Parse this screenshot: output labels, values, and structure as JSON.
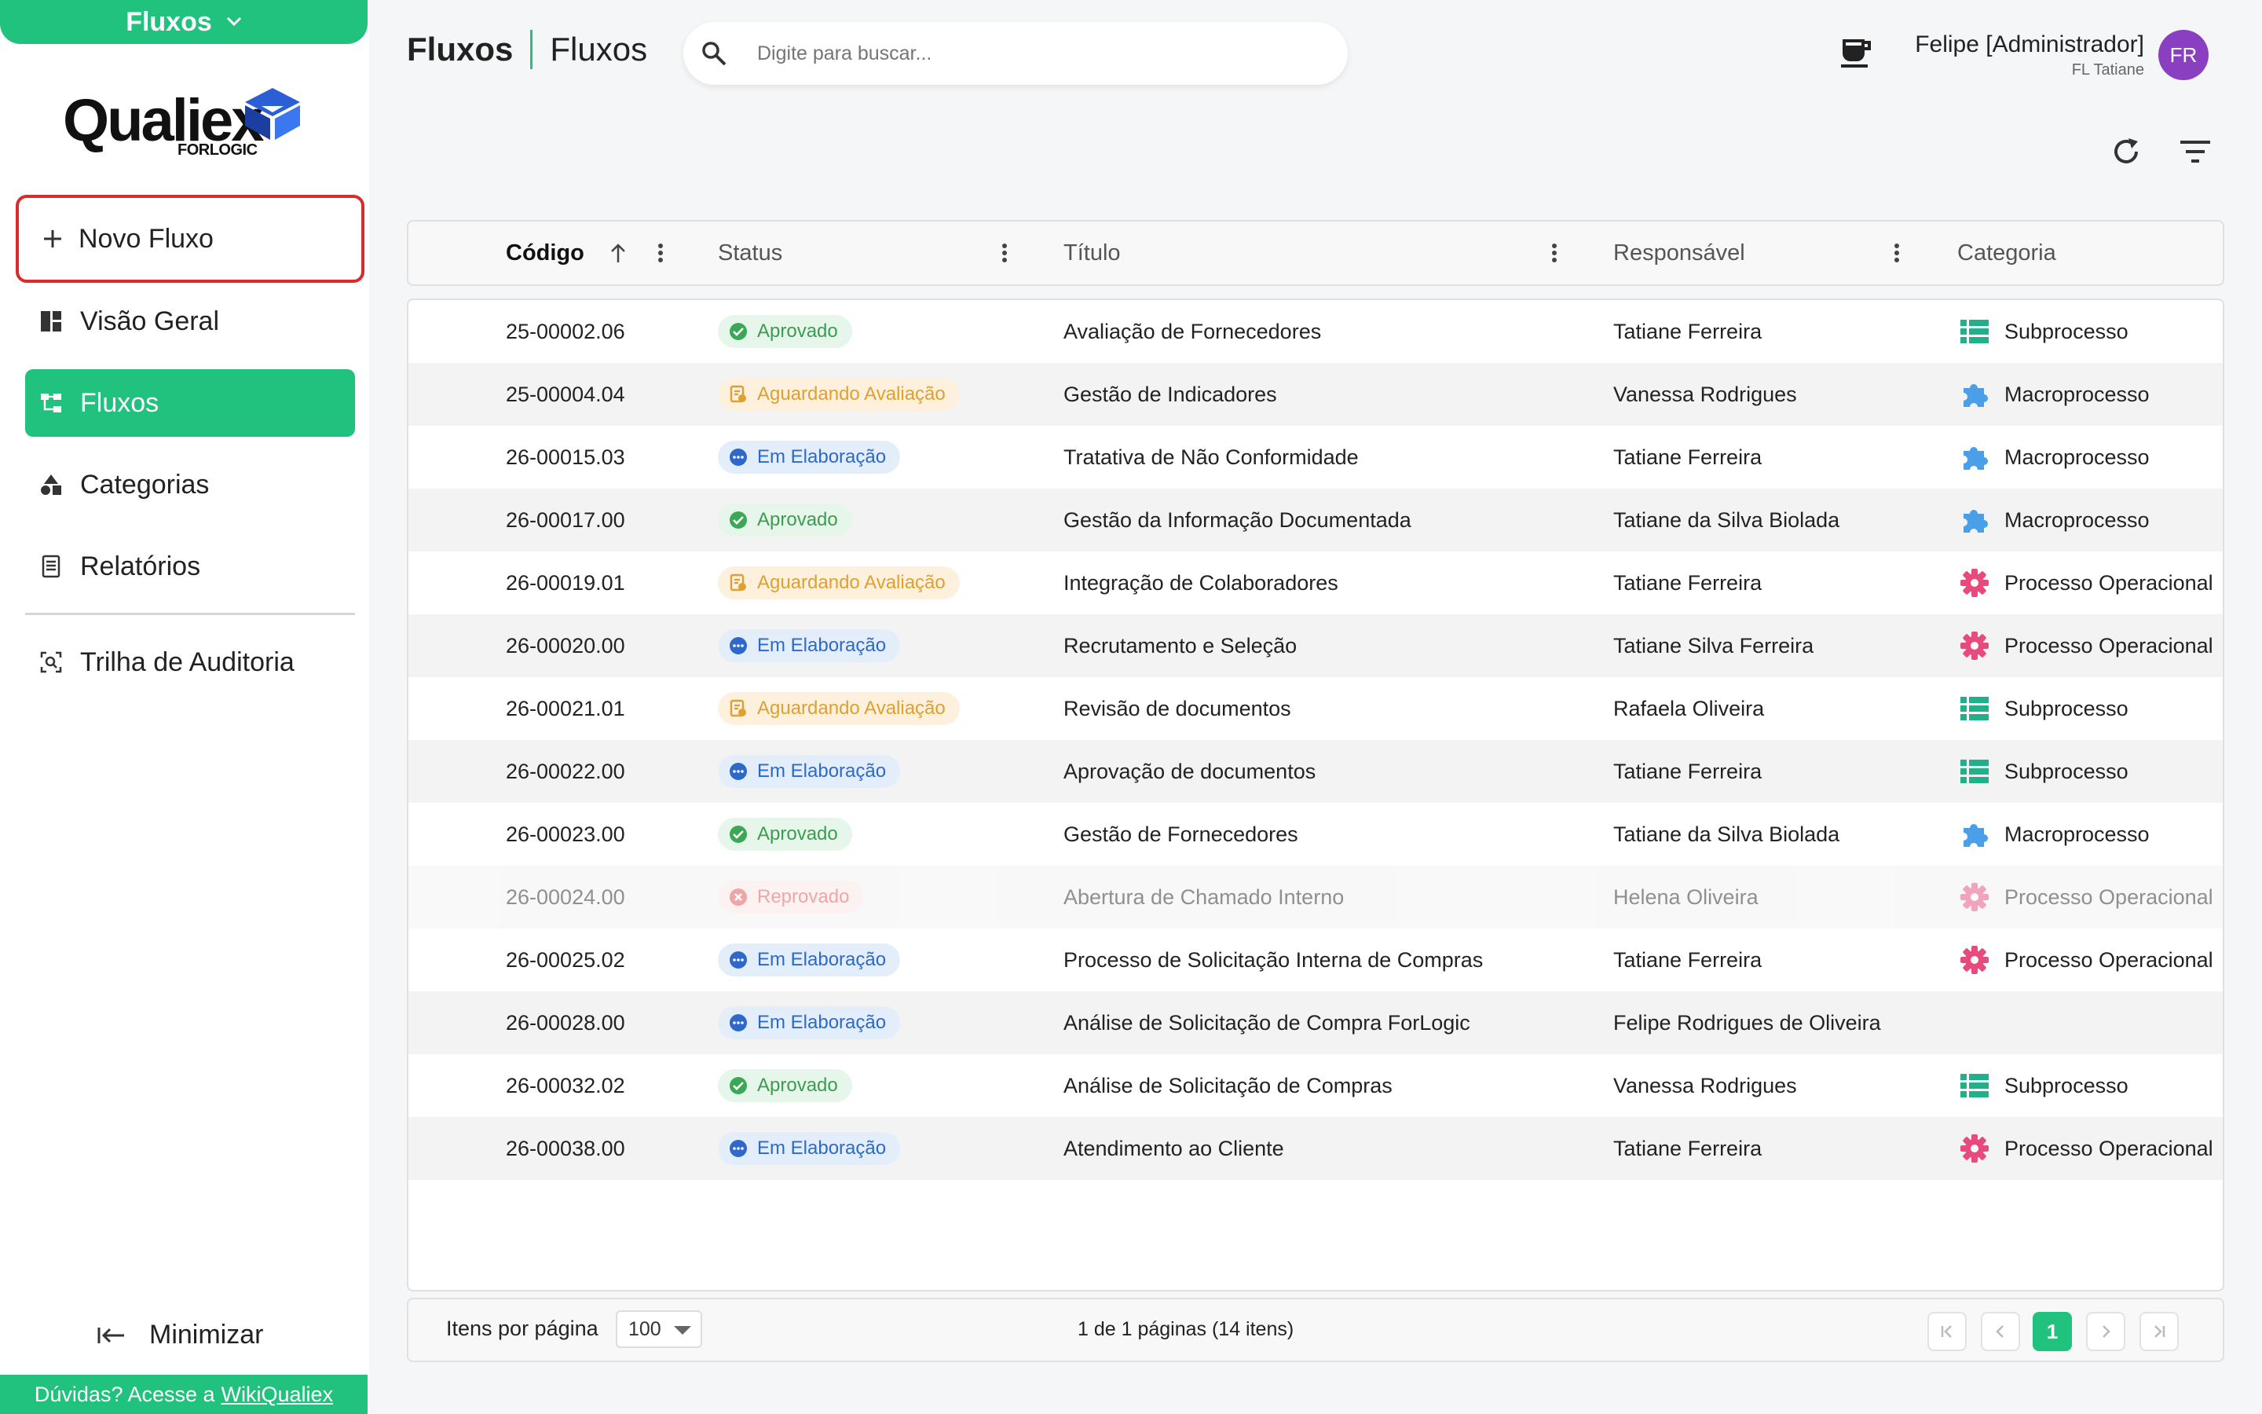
{
  "sidebar": {
    "module": "Fluxos",
    "logo": {
      "word": "Qualiex",
      "sub": "FORLOGIC"
    },
    "new_flow": "Novo Fluxo",
    "items": [
      {
        "label": "Visão Geral",
        "icon": "dashboard-icon"
      },
      {
        "label": "Fluxos",
        "icon": "flow-icon"
      },
      {
        "label": "Categorias",
        "icon": "shapes-icon"
      },
      {
        "label": "Relatórios",
        "icon": "report-icon"
      },
      {
        "label": "Trilha de Auditoria",
        "icon": "audit-icon"
      }
    ],
    "minimize": "Minimizar",
    "help_text": "Dúvidas? Acesse a",
    "help_link": "WikiQualiex"
  },
  "header": {
    "module": "Fluxos",
    "page": "Fluxos",
    "search_placeholder": "Digite para buscar...",
    "user_name": "Felipe [Administrador]",
    "user_sub": "FL Tatiane",
    "avatar": "FR"
  },
  "colors": {
    "accent": "#21c17e",
    "highlight": "#d92b2b",
    "avatar": "#8a3fc1"
  },
  "table": {
    "columns": {
      "code": "Código",
      "status": "Status",
      "title": "Título",
      "responsible": "Responsável",
      "category": "Categoria"
    },
    "rows": [
      {
        "code": "25-00002.06",
        "status": "Aprovado",
        "title": "Avaliação de Fornecedores",
        "responsible": "Tatiane Ferreira",
        "category": "Subprocesso"
      },
      {
        "code": "25-00004.04",
        "status": "Aguardando Avaliação",
        "title": "Gestão de Indicadores",
        "responsible": "Vanessa Rodrigues",
        "category": "Macroprocesso"
      },
      {
        "code": "26-00015.03",
        "status": "Em Elaboração",
        "title": "Tratativa de Não Conformidade",
        "responsible": "Tatiane Ferreira",
        "category": "Macroprocesso"
      },
      {
        "code": "26-00017.00",
        "status": "Aprovado",
        "title": "Gestão da Informação Documentada",
        "responsible": "Tatiane da Silva Biolada",
        "category": "Macroprocesso"
      },
      {
        "code": "26-00019.01",
        "status": "Aguardando Avaliação",
        "title": "Integração de Colaboradores",
        "responsible": "Tatiane Ferreira",
        "category": "Processo Operacional"
      },
      {
        "code": "26-00020.00",
        "status": "Em Elaboração",
        "title": "Recrutamento e Seleção",
        "responsible": "Tatiane Silva Ferreira",
        "category": "Processo Operacional"
      },
      {
        "code": "26-00021.01",
        "status": "Aguardando Avaliação",
        "title": "Revisão de documentos",
        "responsible": "Rafaela Oliveira",
        "category": "Subprocesso"
      },
      {
        "code": "26-00022.00",
        "status": "Em Elaboração",
        "title": "Aprovação de documentos",
        "responsible": "Tatiane Ferreira",
        "category": "Subprocesso"
      },
      {
        "code": "26-00023.00",
        "status": "Aprovado",
        "title": "Gestão de Fornecedores",
        "responsible": "Tatiane da Silva Biolada",
        "category": "Macroprocesso"
      },
      {
        "code": "26-00024.00",
        "status": "Reprovado",
        "title": "Abertura de Chamado Interno",
        "responsible": "Helena Oliveira",
        "category": "Processo Operacional"
      },
      {
        "code": "26-00025.02",
        "status": "Em Elaboração",
        "title": "Processo de Solicitação Interna de Compras",
        "responsible": "Tatiane Ferreira",
        "category": "Processo Operacional"
      },
      {
        "code": "26-00028.00",
        "status": "Em Elaboração",
        "title": "Análise de Solicitação de Compra ForLogic",
        "responsible": "Felipe Rodrigues de Oliveira",
        "category": ""
      },
      {
        "code": "26-00032.02",
        "status": "Aprovado",
        "title": "Análise de Solicitação de Compras",
        "responsible": "Vanessa Rodrigues",
        "category": "Subprocesso"
      },
      {
        "code": "26-00038.00",
        "status": "Em Elaboração",
        "title": "Atendimento ao Cliente",
        "responsible": "Tatiane Ferreira",
        "category": "Processo Operacional"
      }
    ]
  },
  "footer": {
    "per_page_label": "Itens por página",
    "per_page_value": "100",
    "page_info": "1 de 1 páginas (14 itens)",
    "current_page": "1"
  }
}
